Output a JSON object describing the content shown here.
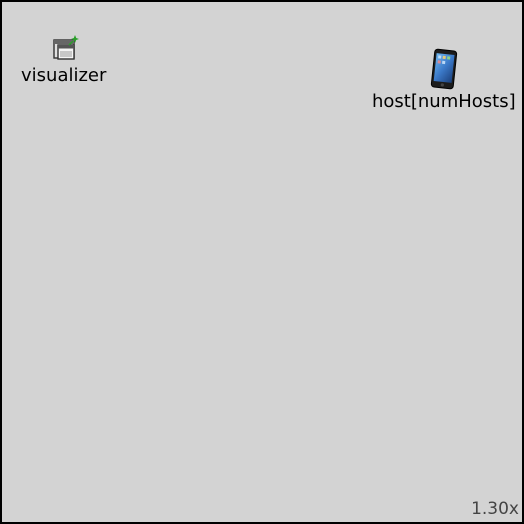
{
  "canvas": {
    "background_color": "#d3d3d3",
    "zoom_label": "1.30x"
  },
  "modules": {
    "visualizer": {
      "label": "visualizer",
      "icon": "visualizer-window-icon"
    },
    "host": {
      "label": "host[numHosts]",
      "icon": "smartphone-icon"
    }
  }
}
